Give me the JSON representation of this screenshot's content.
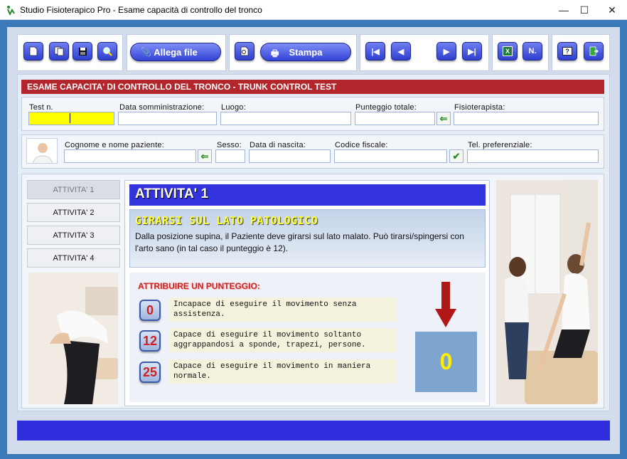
{
  "window": {
    "title": "Studio Fisioterapico Pro - Esame capacità di controllo del tronco",
    "minimize": "—",
    "maximize": "☐",
    "close": "✕"
  },
  "toolbar": {
    "attach_label": "Allega file",
    "print_label": "Stampa",
    "excel_label": "X",
    "number_label": "N.",
    "help_label": "?"
  },
  "section_title": "ESAME CAPACITA' DI CONTROLLO DEL TRONCO - TRUNK CONTROL TEST",
  "exam": {
    "test_n_label": "Test n.",
    "test_n_value": "",
    "date_label": "Data somministrazione:",
    "date_value": "",
    "place_label": "Luogo:",
    "place_value": "",
    "total_label": "Punteggio totale:",
    "total_value": "",
    "therapist_label": "Fisioterapista:",
    "therapist_value": ""
  },
  "patient": {
    "name_label": "Cognome e nome paziente:",
    "name_value": "",
    "sex_label": "Sesso:",
    "sex_value": "",
    "birth_label": "Data di nascita:",
    "birth_value": "",
    "fiscal_label": "Codice fiscale:",
    "fiscal_value": "",
    "phone_label": "Tel. preferenziale:",
    "phone_value": ""
  },
  "activities": [
    {
      "label": "ATTIVITA' 1",
      "active": true
    },
    {
      "label": "ATTIVITA' 2",
      "active": false
    },
    {
      "label": "ATTIVITA' 3",
      "active": false
    },
    {
      "label": "ATTIVITA' 4",
      "active": false
    }
  ],
  "activity_panel": {
    "header": "ATTIVITA' 1",
    "subtitle": "GIRARSI SUL LATO PATOLOGICO",
    "description": "Dalla posizione supina, il Paziente deve girarsi sul lato malato. Può tirarsi/spingersi con l'arto sano (in tal caso il punteggio è 12).",
    "score_prompt": "ATTRIBUIRE UN PUNTEGGIO:",
    "options": [
      {
        "score": "0",
        "text": "Incapace di eseguire il movimento senza assistenza."
      },
      {
        "score": "12",
        "text": "Capace di eseguire il movimento soltanto aggrappandosi a sponde, trapezi, persone."
      },
      {
        "score": "25",
        "text": "Capace di eseguire il movimento in maniera normale."
      }
    ],
    "result": "0"
  },
  "colors": {
    "accent": "#3333dd",
    "section_header": "#b3262c",
    "score_text": "#cc2222",
    "result_bg": "#7ea4d0",
    "result_text": "#ffee00"
  }
}
